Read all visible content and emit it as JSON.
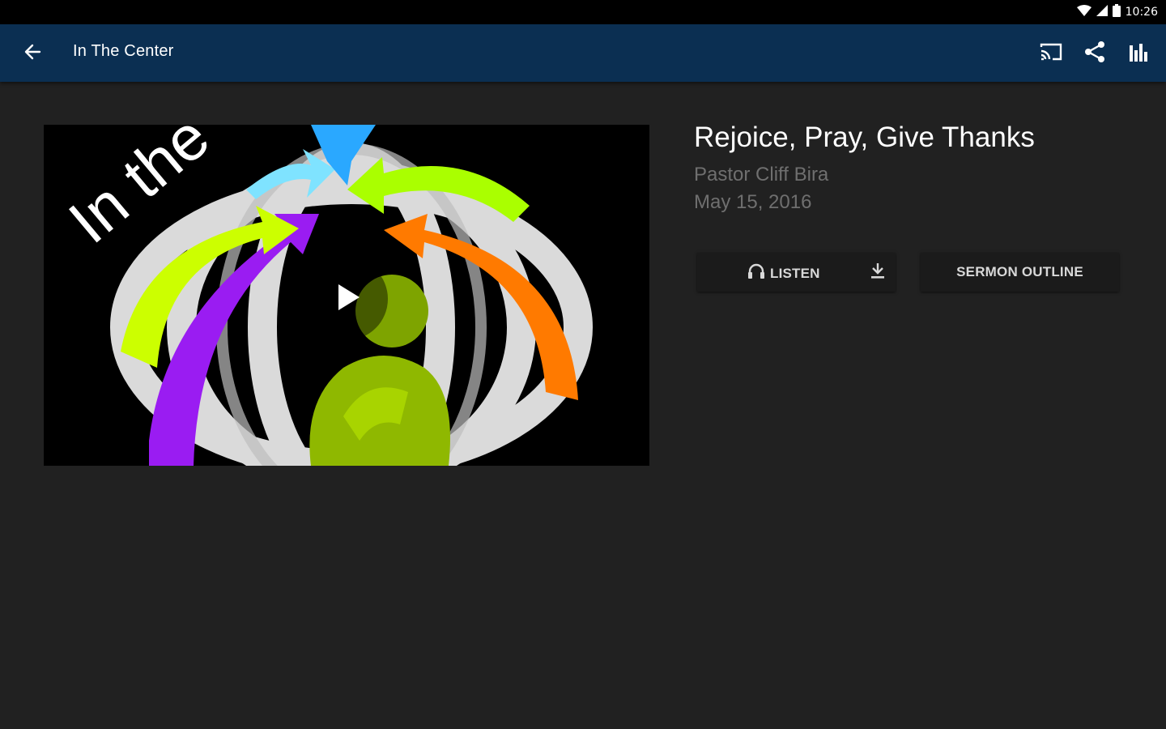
{
  "status_bar": {
    "time": "10:26",
    "icons": [
      "wifi-icon",
      "signal-icon",
      "battery-icon"
    ]
  },
  "app_bar": {
    "title": "In The Center",
    "back_icon": "arrow-left-icon",
    "actions": [
      "cast-icon",
      "share-icon",
      "equalizer-icon"
    ],
    "color": "#0b2f52"
  },
  "thumbnail": {
    "text": "In the",
    "play_icon": "play-icon"
  },
  "sermon": {
    "title": "Rejoice, Pray, Give Thanks",
    "speaker": "Pastor Cliff Bira",
    "date": "May 15, 2016"
  },
  "buttons": {
    "listen_label": "LISTEN",
    "listen_icon": "headphones-icon",
    "download_icon": "download-icon",
    "outline_label": "SERMON OUTLINE"
  }
}
